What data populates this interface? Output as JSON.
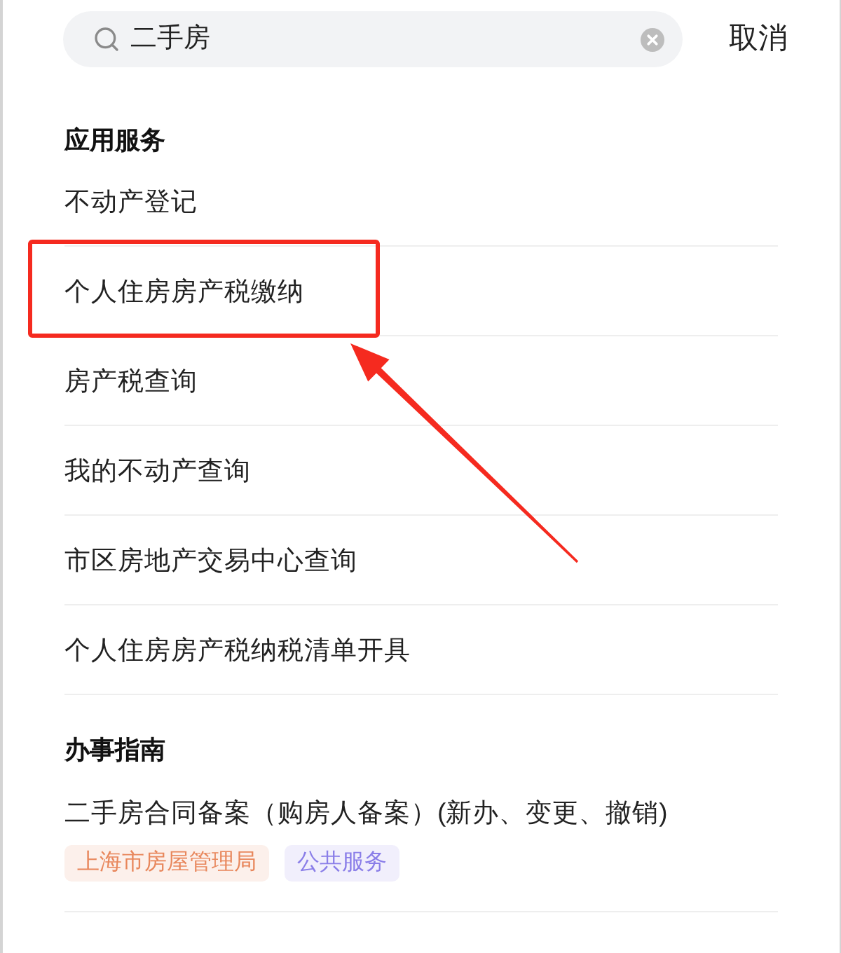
{
  "search": {
    "value": "二手房",
    "cancel_label": "取消"
  },
  "sections": [
    {
      "title": "应用服务",
      "kind": "services",
      "items": [
        {
          "label": "不动产登记",
          "highlighted": false
        },
        {
          "label": "个人住房房产税缴纳",
          "highlighted": true
        },
        {
          "label": "房产税查询",
          "highlighted": false
        },
        {
          "label": "我的不动产查询",
          "highlighted": false
        },
        {
          "label": "市区房地产交易中心查询",
          "highlighted": false
        },
        {
          "label": "个人住房房产税纳税清单开具",
          "highlighted": false
        }
      ]
    },
    {
      "title": "办事指南",
      "kind": "guides",
      "items": [
        {
          "label": "二手房合同备案（购房人备案）(新办、变更、撤销)",
          "tags": [
            {
              "label": "上海市房屋管理局",
              "color": "#e8875c"
            },
            {
              "label": "公共服务",
              "color": "#8a7ee8"
            }
          ]
        }
      ]
    }
  ]
}
